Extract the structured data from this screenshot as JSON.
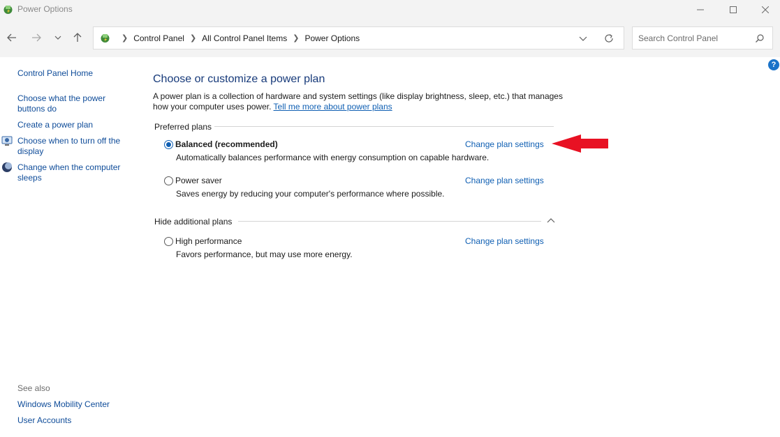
{
  "window": {
    "title": "Power Options",
    "minimize_icon": "minimize-icon",
    "maximize_icon": "maximize-icon",
    "close_icon": "close-icon"
  },
  "nav": {
    "breadcrumbs": [
      "Control Panel",
      "All Control Panel Items",
      "Power Options"
    ],
    "search_placeholder": "Search Control Panel"
  },
  "sidebar": {
    "home": "Control Panel Home",
    "items": [
      {
        "label": "Choose what the power buttons do"
      },
      {
        "label": "Create a power plan"
      },
      {
        "label": "Choose when to turn off the display"
      },
      {
        "label": "Change when the computer sleeps"
      }
    ],
    "see_also_label": "See also",
    "see_also": [
      {
        "label": "Windows Mobility Center"
      },
      {
        "label": "User Accounts"
      }
    ]
  },
  "main": {
    "title": "Choose or customize a power plan",
    "description": "A power plan is a collection of hardware and system settings (like display brightness, sleep, etc.) that manages how your computer uses power.",
    "learn_more_link": "Tell me more about power plans",
    "preferred_header": "Preferred plans",
    "additional_header": "Hide additional plans",
    "change_link": "Change plan settings",
    "plans": [
      {
        "name": "Balanced (recommended)",
        "description": "Automatically balances performance with energy consumption on capable hardware.",
        "selected": true
      },
      {
        "name": "Power saver",
        "description": "Saves energy by reducing your computer's performance where possible.",
        "selected": false
      },
      {
        "name": "High performance",
        "description": "Favors performance, but may use more energy.",
        "selected": false
      }
    ]
  },
  "colors": {
    "link": "#0f5fb3",
    "title": "#173a7a",
    "annotation_arrow": "#e81123"
  }
}
